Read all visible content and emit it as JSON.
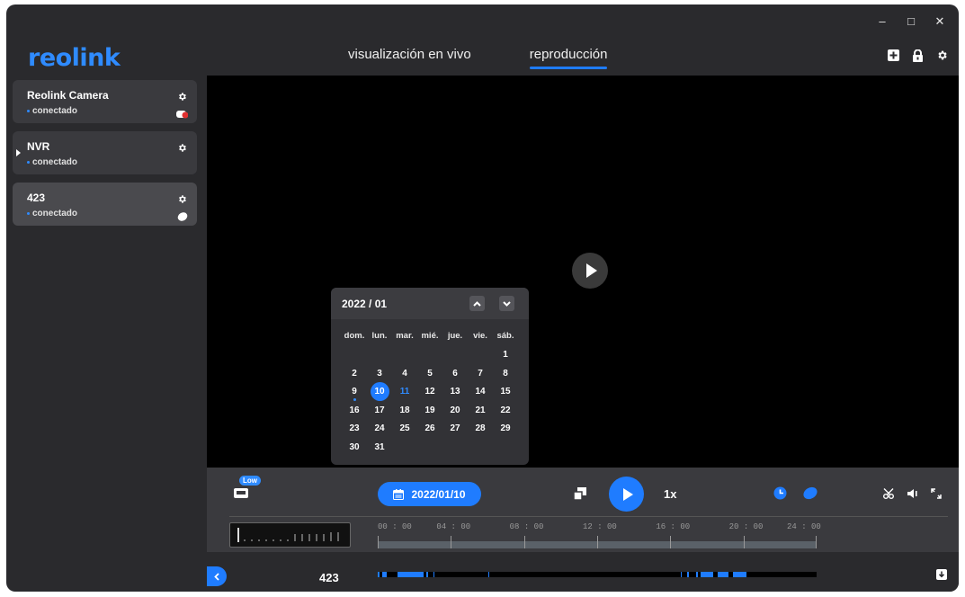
{
  "window": {
    "controls": [
      "–",
      "□",
      "✕"
    ]
  },
  "brand": {
    "logo": "reolink",
    "accent": "#1f7cff"
  },
  "tabs": [
    {
      "label": "visualización en vivo",
      "active": false
    },
    {
      "label": "reproducción",
      "active": true
    }
  ],
  "topbar_icons": [
    "add-device-icon",
    "lock-icon",
    "settings-gear-icon"
  ],
  "devices": [
    {
      "name": "Reolink Camera",
      "status": "conectado",
      "icon": "camera-icon"
    },
    {
      "name": "NVR",
      "status": "conectado",
      "icon": ""
    },
    {
      "name": "423",
      "status": "conectado",
      "icon": "camera-icon",
      "selected": true
    }
  ],
  "calendar": {
    "month_label": "2022 / 01",
    "weekdays": [
      "dom.",
      "lun.",
      "mar.",
      "mié.",
      "jue.",
      "vie.",
      "sáb."
    ],
    "first_weekday_index": 6,
    "days_in_month": 31,
    "selected_day": 10,
    "today": 11,
    "recorded_days": [
      9
    ]
  },
  "controls": {
    "quality_badge": "Low",
    "date": "2022/01/10",
    "speed": "1x"
  },
  "timeline": {
    "labels": [
      "00 : 00",
      "04 : 00",
      "08 : 00",
      "12 : 00",
      "16 : 00",
      "20 : 00",
      "24 : 00"
    ]
  },
  "bottom": {
    "channel": "423",
    "recorded_fraction_segments": [
      [
        0.0,
        0.005
      ],
      [
        0.01,
        0.02
      ],
      [
        0.045,
        0.105
      ],
      [
        0.11,
        0.115
      ],
      [
        0.127,
        0.13
      ],
      [
        0.252,
        0.255
      ],
      [
        0.69,
        0.693
      ],
      [
        0.705,
        0.708
      ],
      [
        0.725,
        0.73
      ],
      [
        0.735,
        0.765
      ],
      [
        0.775,
        0.8
      ],
      [
        0.81,
        0.84
      ]
    ]
  }
}
